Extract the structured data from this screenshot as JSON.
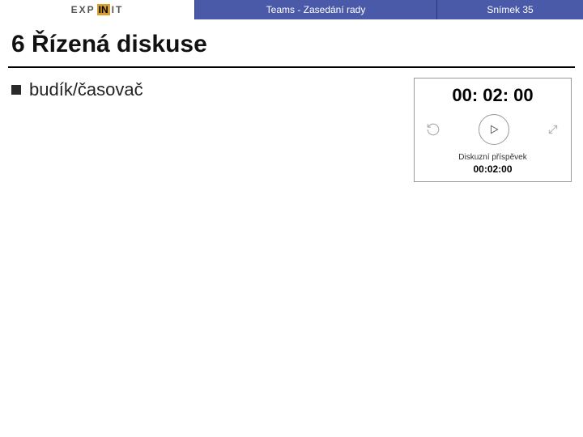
{
  "header": {
    "logo_pre": "EXP",
    "logo_mid": "IN",
    "logo_post": "IT",
    "title": "Teams - Zasedání rady",
    "slide_label": "Snímek 35"
  },
  "slide": {
    "title": "6 Řízená diskuse",
    "bullet1": "budík/časovač"
  },
  "timer": {
    "big": "00: 02: 00",
    "label": "Diskuzní příspěvek",
    "small": "00:02:00"
  }
}
